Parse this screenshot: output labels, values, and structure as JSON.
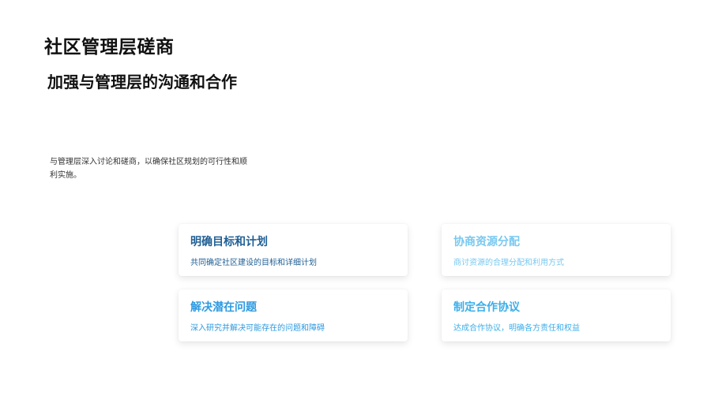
{
  "slide": {
    "title": "社区管理层磋商",
    "subtitle": "加强与管理层的沟通和合作",
    "description": "与管理层深入讨论和磋商，以确保社区规划的可行性和顺利实施。"
  },
  "cards": [
    {
      "title": "明确目标和计划",
      "text": "共同确定社区建设的目标和详细计划",
      "color": "#1f5f94"
    },
    {
      "title": "协商资源分配",
      "text": "商讨资源的合理分配和利用方式",
      "color": "#78c8f0"
    },
    {
      "title": "解决潜在问题",
      "text": "深入研究并解决可能存在的问题和障碍",
      "color": "#2d9ae0"
    },
    {
      "title": "制定合作协议",
      "text": "达成合作协议，明确各方责任和权益",
      "color": "#3aaeea"
    }
  ]
}
